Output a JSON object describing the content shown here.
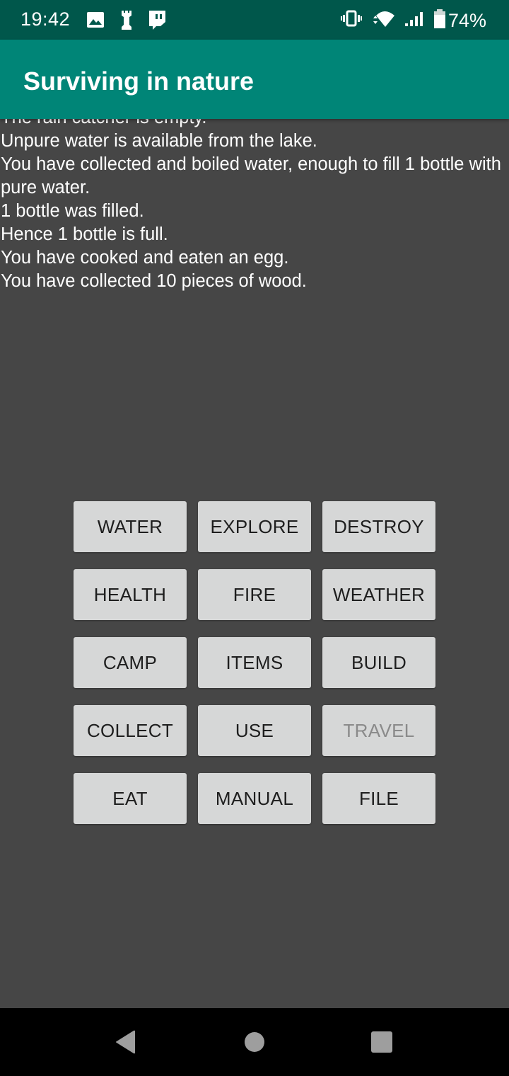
{
  "status_bar": {
    "time": "19:42",
    "left_icons": [
      "image-icon",
      "chess-rook-icon",
      "twitch-icon"
    ],
    "right_icons": [
      "vibrate-icon",
      "wifi-icon",
      "signal-icon",
      "battery-icon"
    ],
    "battery_percent": "74%"
  },
  "app_bar": {
    "title": "Surviving in nature"
  },
  "log": {
    "lines": [
      "The rain catcher is empty.",
      "Unpure water is available from the lake.",
      "You have collected and boiled water, enough to fill 1 bottle with pure water.",
      "1 bottle was filled.",
      "Hence 1 bottle is full.",
      "You have cooked and eaten an egg.",
      "You have collected 10 pieces of wood."
    ]
  },
  "actions": [
    {
      "label": "WATER",
      "enabled": true
    },
    {
      "label": "EXPLORE",
      "enabled": true
    },
    {
      "label": "DESTROY",
      "enabled": true
    },
    {
      "label": "HEALTH",
      "enabled": true
    },
    {
      "label": "FIRE",
      "enabled": true
    },
    {
      "label": "WEATHER",
      "enabled": true
    },
    {
      "label": "CAMP",
      "enabled": true
    },
    {
      "label": "ITEMS",
      "enabled": true
    },
    {
      "label": "BUILD",
      "enabled": true
    },
    {
      "label": "COLLECT",
      "enabled": true
    },
    {
      "label": "USE",
      "enabled": true
    },
    {
      "label": "TRAVEL",
      "enabled": false
    },
    {
      "label": "EAT",
      "enabled": true
    },
    {
      "label": "MANUAL",
      "enabled": true
    },
    {
      "label": "FILE",
      "enabled": true
    }
  ],
  "nav_bar": {
    "buttons": [
      "back-icon",
      "home-icon",
      "recents-icon"
    ]
  },
  "colors": {
    "status_bar": "#00574b",
    "app_bar": "#008577",
    "background": "#464646",
    "button": "#d6d7d7",
    "button_text": "#1e1e1e",
    "button_text_disabled": "#8a8a8a"
  }
}
